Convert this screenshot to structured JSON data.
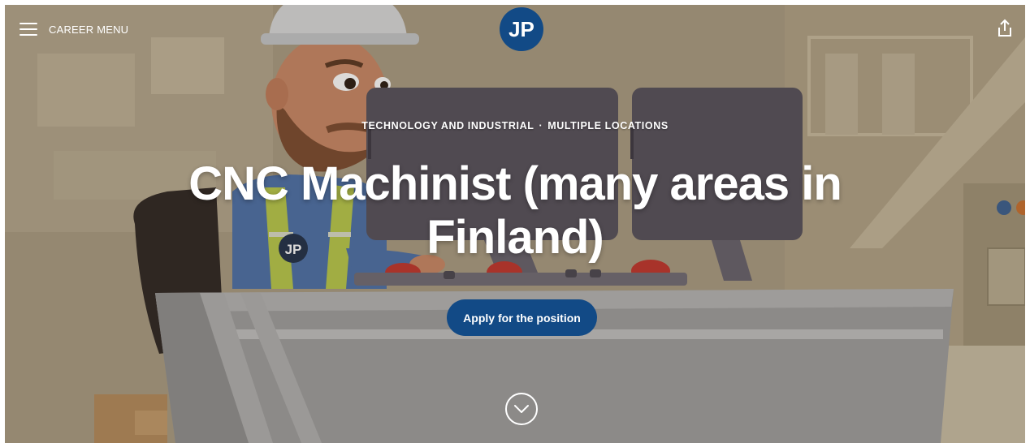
{
  "header": {
    "menu_label": "CAREER MENU",
    "logo_text": "JP"
  },
  "hero": {
    "category": "TECHNOLOGY AND INDUSTRIAL",
    "separator": "·",
    "location": "MULTIPLE LOCATIONS",
    "title": "CNC Machinist (many areas in Finland)",
    "apply_label": "Apply for the position",
    "badge_text": "JP"
  },
  "colors": {
    "brand_blue": "#124a86",
    "text_white": "#ffffff"
  },
  "icons": [
    "menu-icon",
    "share-icon",
    "chevron-down-icon"
  ]
}
